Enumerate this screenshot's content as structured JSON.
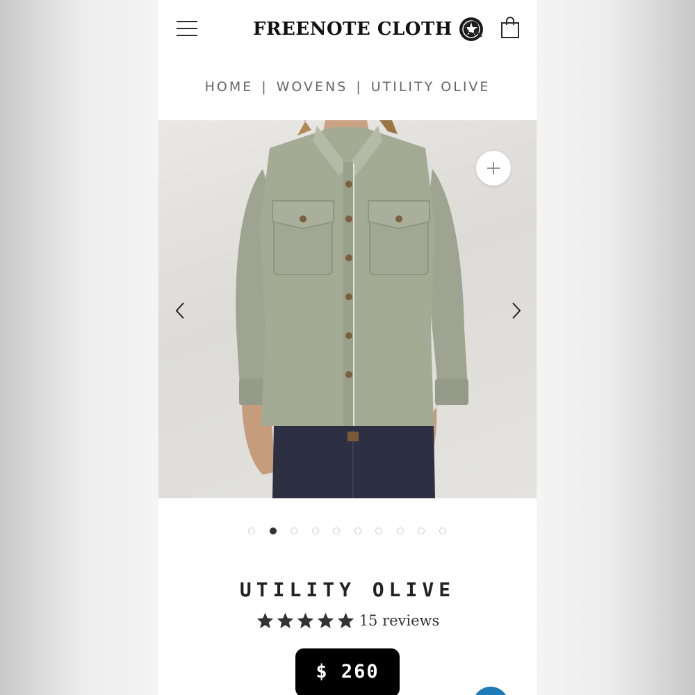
{
  "header": {
    "logo_text": "FREENOTE CLOTH",
    "icons": [
      "menu-icon",
      "search-icon",
      "cart-icon",
      "star-emblem-icon"
    ]
  },
  "breadcrumb": {
    "items": [
      "HOME",
      "WOVENS",
      "UTILITY OLIVE"
    ],
    "separator": "|"
  },
  "gallery": {
    "image_subject": "olive utility work shirt",
    "slide_count": 10,
    "active_slide": 2,
    "zoom_icon": "plus-icon",
    "prev_icon": "chevron-left-icon",
    "next_icon": "chevron-right-icon"
  },
  "product": {
    "title": "UTILITY OLIVE",
    "rating_stars": 5,
    "reviews_label": "15 reviews",
    "price": "$ 260"
  },
  "colors": {
    "shirt": "#a4ab95",
    "price_bg": "#000000",
    "chat_button": "#1f7ab8"
  }
}
